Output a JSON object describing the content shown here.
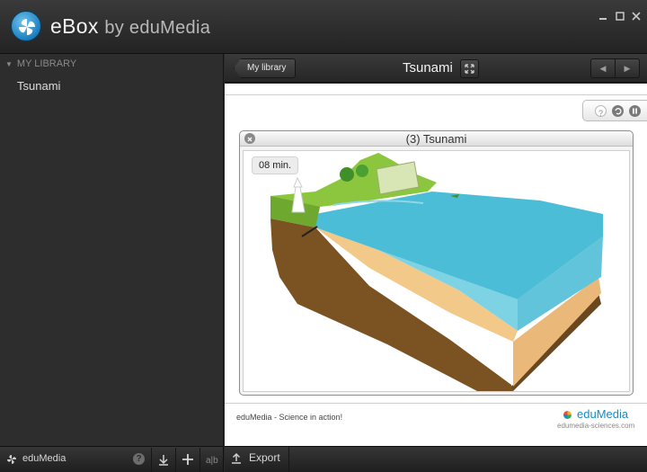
{
  "window": {
    "app_name": "eBox",
    "app_by": "by eduMedia",
    "controls": [
      "minimize-icon",
      "maximize-icon",
      "close-icon"
    ]
  },
  "sidebar": {
    "header": "MY LIBRARY",
    "items": [
      {
        "label": "Tsunami"
      }
    ],
    "bottom": {
      "user_label": "eduMedia",
      "help_label": "?",
      "action_icons": [
        "download-icon",
        "plus-icon",
        "sort-icon"
      ]
    }
  },
  "content_header": {
    "back_label": "My library",
    "title": "Tsunami",
    "nav_icons": [
      "expand-icon",
      "previous-icon",
      "next-icon"
    ]
  },
  "simulation": {
    "title": "(3) Tsunami",
    "time_label": "08 min.",
    "control_icons": [
      "help-icon",
      "reset-icon",
      "pause-icon"
    ]
  },
  "footer": {
    "tagline": "eduMedia - Science in action!",
    "brand": "eduMedia",
    "url": "edumedia-sciences.com"
  },
  "bottom_bar": {
    "export_label": "Export"
  },
  "colors": {
    "chrome": "#2a2a2a",
    "accent_blue": "#1a8ac7",
    "water": "#4cbdd6",
    "water_side": "#7dd3e3",
    "sand": "#f3c98a",
    "soil": "#7b5222",
    "grass": "#8cc63f"
  }
}
